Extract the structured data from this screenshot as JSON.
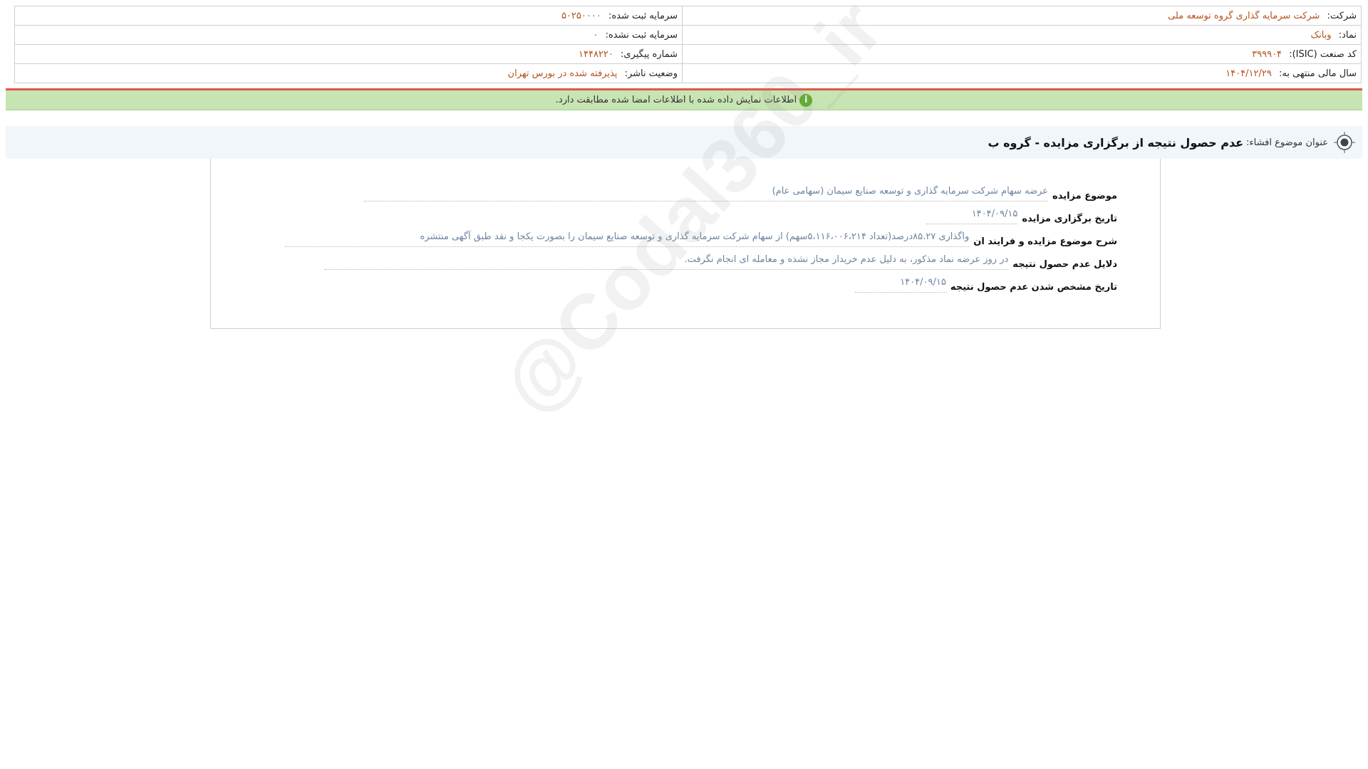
{
  "header": {
    "company_label": "شرکت:",
    "company_value": "شرکت سرمایه گذاری گروه توسعه ملی",
    "registered_capital_label": "سرمایه ثبت شده:",
    "registered_capital_value": "۵۰۲۵۰۰۰۰",
    "symbol_label": "نماد:",
    "symbol_value": "وبانک",
    "unregistered_capital_label": "سرمایه ثبت نشده:",
    "unregistered_capital_value": "۰",
    "isic_label": "کد صنعت (ISIC):",
    "isic_value": "۳۹۹۹۰۴",
    "tracking_label": "شماره پیگیری:",
    "tracking_value": "۱۴۴۸۲۲۰",
    "fiscal_label": "سال مالی منتهی به:",
    "fiscal_value": "۱۴۰۴/۱۲/۲۹",
    "status_label": "وضعیت ناشر:",
    "status_value": "پذیرفته شده در بورس تهران"
  },
  "notice": {
    "icon": "info-icon",
    "text": "اطلاعات نمایش داده شده با اطلاعات امضا شده مطابقت دارد."
  },
  "title": {
    "label": "عنوان موضوع افشاء:",
    "text": "عدم حصول نتیجه از برگزاری مزایده - گروه ب"
  },
  "details": [
    {
      "label": "موضوع مزایده",
      "value": "عرضه سهام شرکت سرمایه گذاری و توسعه صنایع سیمان (سهامی عام)"
    },
    {
      "label": "تاریخ برگزاری مزایده",
      "value": "۱۴۰۴/۰۹/۱۵"
    },
    {
      "label": "شرح موضوع مزایده و فرایند ان",
      "value": "واگذاری ۸۵.۲۷درصد(تعداد ۵،۱۱۶،۰۰۶،۲۱۴سهم) از سهام شرکت سرمایه گذاری و توسعه صنایع سیمان را بصورت یکجا و نقد طبق آگهی منتشره"
    },
    {
      "label": "دلایل عدم حصول نتیجه",
      "value": "در روز عرضه نماد مذکور، به دلیل عدم خریدار مجاز نشده و معامله ای انجام نگرفت."
    },
    {
      "label": "تاریخ مشخص شدن عدم حصول نتیجه",
      "value": "۱۴۰۴/۰۹/۱۵"
    }
  ],
  "watermark": "@Codal360_ir",
  "colors": {
    "value_orange": "#b5501e",
    "detail_value": "#6c84a0",
    "notice_bg": "#c7e4b3",
    "notice_border": "#e2564a",
    "title_bg": "#f1f6fb"
  }
}
